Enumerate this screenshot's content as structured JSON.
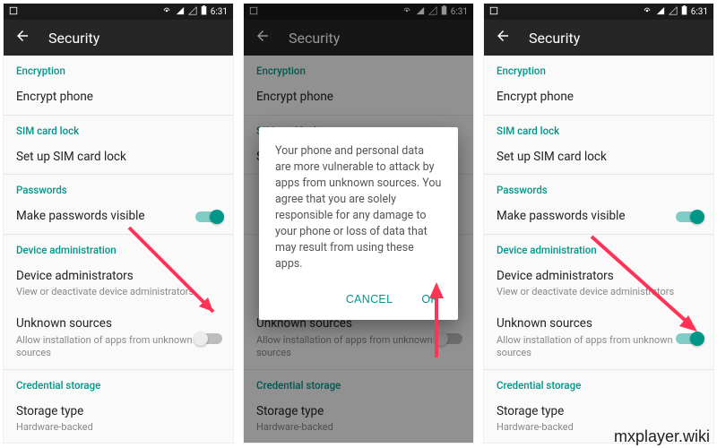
{
  "status": {
    "time": "6:31"
  },
  "appbar": {
    "title": "Security"
  },
  "sections": {
    "encryption": {
      "header": "Encryption",
      "encrypt": "Encrypt phone"
    },
    "sim": {
      "header": "SIM card lock",
      "setup": "Set up SIM card lock"
    },
    "passwords": {
      "header": "Passwords",
      "visible": "Make passwords visible"
    },
    "device_admin": {
      "header": "Device administration",
      "admins_primary": "Device administrators",
      "admins_secondary": "View or deactivate device administrators",
      "unknown_primary": "Unknown sources",
      "unknown_secondary": "Allow installation of apps from unknown sources"
    },
    "credential": {
      "header": "Credential storage",
      "storage_primary": "Storage type",
      "storage_secondary": "Hardware-backed"
    }
  },
  "dialog": {
    "message": "Your phone and personal data are more vulnerable to attack by apps from unknown sources. You agree that you are solely responsible for any damage to your phone or loss of data that may result from using these apps.",
    "cancel": "CANCEL",
    "ok": "OK"
  },
  "watermark": "mxplayer.wiki",
  "screens": {
    "left_unknown_toggle": "off",
    "right_unknown_toggle": "on"
  }
}
